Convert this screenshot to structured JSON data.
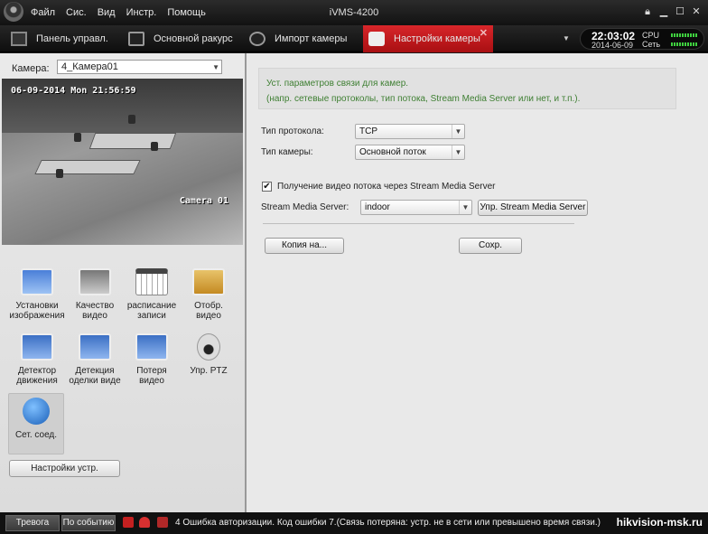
{
  "window": {
    "title": "iVMS-4200",
    "menu": [
      "Файл",
      "Сис.",
      "Вид",
      "Инстр.",
      "Помощь"
    ]
  },
  "tabs": [
    {
      "label": "Панель управл.",
      "icon": "control-panel-icon"
    },
    {
      "label": "Основной ракурс",
      "icon": "monitor-icon"
    },
    {
      "label": "Импорт камеры",
      "icon": "camera-import-icon"
    },
    {
      "label": "Настройки камеры",
      "icon": "camera-settings-icon",
      "active": true
    }
  ],
  "status_widget": {
    "time": "22:03:02",
    "date": "2014-06-09",
    "cpu_label": "CPU",
    "net_label": "Сеть"
  },
  "left": {
    "camera_label": "Камера:",
    "camera_value": "4_Камера01",
    "osd_time": "06-09-2014 Mon 21:56:59",
    "osd_name": "Camera 01",
    "icons": [
      {
        "label": "Установки изображения",
        "icon": "image-settings-icon"
      },
      {
        "label": "Качество видео",
        "icon": "video-quality-icon"
      },
      {
        "label": "расписание записи",
        "icon": "record-schedule-icon"
      },
      {
        "label": "Отобр. видео",
        "icon": "video-display-icon"
      },
      {
        "label": "Детектор движения",
        "icon": "motion-detection-icon"
      },
      {
        "label": "Детекция оделки виде",
        "icon": "tamper-detection-icon"
      },
      {
        "label": "Потеря видео",
        "icon": "video-loss-icon"
      },
      {
        "label": "Упр. PTZ",
        "icon": "ptz-icon"
      },
      {
        "label": "Сет. соед.",
        "icon": "network-icon",
        "selected": true
      }
    ],
    "device_settings_btn": "Настройки устр."
  },
  "right": {
    "info_line1": "Уст. параметров связи для камер.",
    "info_line2": "(напр. сетевые протоколы, тип потока, Stream Media Server или нет, и т.п.).",
    "protocol_label": "Тип протокола:",
    "protocol_value": "TCP",
    "stream_label": "Тип камеры:",
    "stream_value": "Основной поток",
    "sms_checkbox_label": "Получение видео потока через Stream Media Server",
    "sms_checked": true,
    "sms_label": "Stream Media Server:",
    "sms_value": "indoor",
    "sms_manage_btn": "Упр. Stream Media Server",
    "copy_btn": "Копия на...",
    "save_btn": "Сохр."
  },
  "statusbar": {
    "alarm_btn": "Тревога",
    "event_btn": "По событию",
    "message": "4 Ошибка авторизации. Код ошибки 7.(Связь потеряна: устр. не в сети или превышено время связи.)",
    "watermark": "hikvision-msk.ru"
  }
}
